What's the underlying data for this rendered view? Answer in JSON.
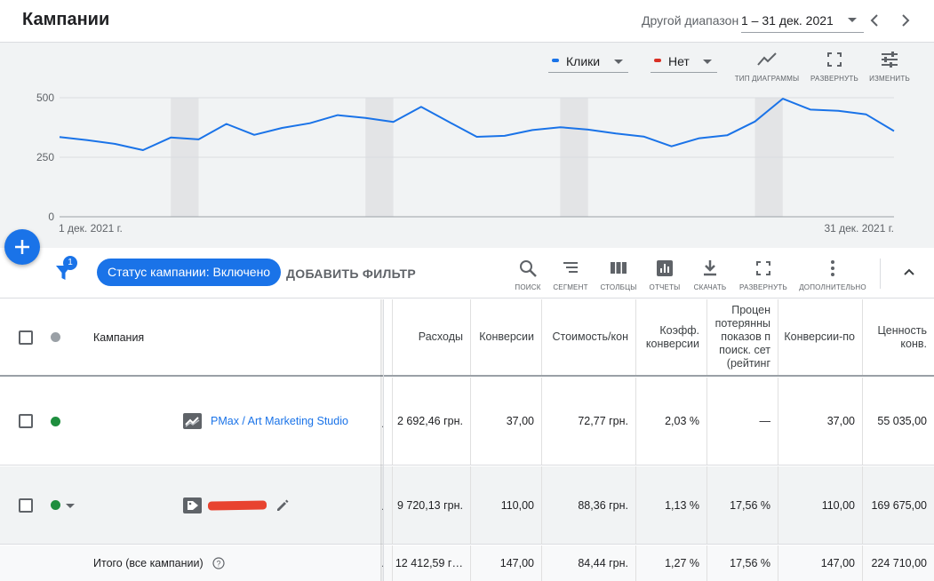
{
  "header": {
    "title": "Кампании",
    "range_label": "Другой диапазон",
    "range_value": "1 – 31 дек. 2021"
  },
  "chart_controls": {
    "metric1": {
      "label": "Клики",
      "color": "#1a73e8"
    },
    "metric2": {
      "label": "Нет",
      "color": "#d93025"
    },
    "tools": [
      {
        "label": "ТИП ДИАГРАММЫ",
        "icon": "chart-type-icon"
      },
      {
        "label": "РАЗВЕРНУТЬ",
        "icon": "fullscreen-icon"
      },
      {
        "label": "ИЗМЕНИТЬ",
        "icon": "tune-icon"
      }
    ]
  },
  "chart_data": {
    "type": "line",
    "title": "",
    "ylim": [
      0,
      500
    ],
    "yticks": [
      "500",
      "250",
      "0"
    ],
    "x_start_label": "1 дек. 2021 г.",
    "x_end_label": "31 дек. 2021 г.",
    "weekend_bands": [
      4,
      5,
      11,
      12,
      18,
      19,
      25,
      26
    ],
    "series": [
      {
        "name": "Клики",
        "color": "#1a73e8",
        "values": [
          335,
          322,
          306,
          280,
          333,
          325,
          390,
          344,
          373,
          393,
          427,
          415,
          398,
          462,
          398,
          336,
          340,
          364,
          376,
          366,
          350,
          337,
          296,
          330,
          342,
          400,
          496,
          450,
          445,
          430,
          360
        ]
      }
    ]
  },
  "filterbar": {
    "filter_count": "1",
    "chip_label": "Статус кампании: Включено",
    "add_filter": "ДОБАВИТЬ ФИЛЬТР",
    "tools": [
      {
        "label": "ПОИСК",
        "icon": "search-icon"
      },
      {
        "label": "СЕГМЕНТ",
        "icon": "segment-icon"
      },
      {
        "label": "СТОЛБЦЫ",
        "icon": "columns-icon"
      },
      {
        "label": "ОТЧЕТЫ",
        "icon": "reports-icon"
      },
      {
        "label": "СКАЧАТЬ",
        "icon": "download-icon"
      },
      {
        "label": "РАЗВЕРНУТЬ",
        "icon": "fullscreen-icon"
      },
      {
        "label": "ДОПОЛНИТЕЛЬНО",
        "icon": "more-icon"
      }
    ]
  },
  "table": {
    "campaign_header": "Кампания",
    "columns": [
      {
        "label": "Расходы"
      },
      {
        "label": "Конверсии"
      },
      {
        "label": "Стоимость/кон"
      },
      {
        "label": "Коэфф. конверсии"
      },
      {
        "label": "Процен потерянны показов п поиск. сет (рейтинг"
      },
      {
        "label": "Конверсии-по"
      },
      {
        "label": "Ценность конв."
      }
    ],
    "rows": [
      {
        "campaign": "PMax / Art Marketing Studio",
        "status_color": "#1e8e3e",
        "type_icon": "performance-max-icon",
        "values": [
          "2 692,46 грн.",
          "37,00",
          "72,77 грн.",
          "2,03 %",
          "—",
          "37,00",
          "55 035,00"
        ]
      },
      {
        "campaign": "",
        "status_color": "#1e8e3e",
        "type_icon": "tag-icon",
        "values": [
          "9 720,13 грн.",
          "110,00",
          "88,36 грн.",
          "1,13 %",
          "17,56 %",
          "110,00",
          "169 675,00"
        ]
      }
    ],
    "total": {
      "label": "Итого (все кампании)",
      "values": [
        "12 412,59 г…",
        "147,00",
        "84,44 грн.",
        "1,27 %",
        "17,56 %",
        "147,00",
        "224 710,00"
      ]
    }
  }
}
